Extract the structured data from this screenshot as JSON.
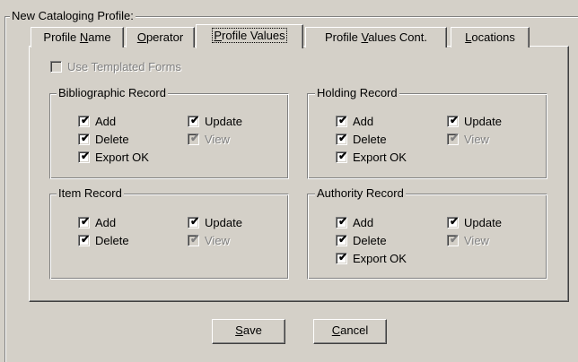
{
  "outer_group": {
    "legend": "New Cataloging Profile:"
  },
  "tabs": [
    {
      "pre": "Profile ",
      "key": "N",
      "post": "ame",
      "active": false
    },
    {
      "pre": "",
      "key": "O",
      "post": "perator",
      "active": false
    },
    {
      "pre": "",
      "key": "P",
      "post": "rofile Values",
      "active": true
    },
    {
      "pre": "Profile ",
      "key": "V",
      "post": "alues Cont.",
      "active": false
    },
    {
      "pre": "",
      "key": "L",
      "post": "ocations",
      "active": false
    }
  ],
  "templated_forms": {
    "label": "Use Templated Forms",
    "checked": false,
    "enabled": false
  },
  "groups": {
    "bibliographic": {
      "legend": "Bibliographic Record",
      "add": "Add",
      "update": "Update",
      "delete": "Delete",
      "view": "View",
      "export": "Export OK"
    },
    "holding": {
      "legend": "Holding Record",
      "add": "Add",
      "update": "Update",
      "delete": "Delete",
      "view": "View",
      "export": "Export OK"
    },
    "item": {
      "legend": "Item Record",
      "add": "Add",
      "update": "Update",
      "delete": "Delete",
      "view": "View"
    },
    "authority": {
      "legend": "Authority Record",
      "add": "Add",
      "update": "Update",
      "delete": "Delete",
      "view": "View",
      "export": "Export OK"
    }
  },
  "buttons": {
    "save": {
      "key": "S",
      "rest": "ave"
    },
    "cancel": {
      "key": "C",
      "rest": "ancel"
    }
  },
  "glyphs": {
    "check": "✔"
  },
  "colors": {
    "face": "#d4d0c8",
    "shadow": "#808080",
    "highlight": "#ffffff",
    "disabled_text": "#808080"
  }
}
